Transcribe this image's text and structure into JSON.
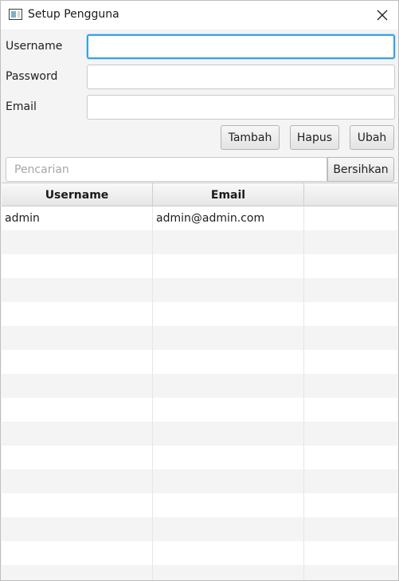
{
  "window": {
    "title": "Setup Pengguna",
    "icon": "app-window-icon",
    "close_icon": "close-icon"
  },
  "form": {
    "username": {
      "label": "Username",
      "value": "",
      "placeholder": ""
    },
    "password": {
      "label": "Password",
      "value": "",
      "placeholder": ""
    },
    "email": {
      "label": "Email",
      "value": "",
      "placeholder": ""
    }
  },
  "actions": {
    "add_label": "Tambah",
    "delete_label": "Hapus",
    "edit_label": "Ubah"
  },
  "search": {
    "placeholder": "Pencarian",
    "value": "",
    "clear_label": "Bersihkan"
  },
  "table": {
    "columns": [
      "Username",
      "Email",
      ""
    ],
    "rows": [
      [
        "admin",
        "admin@admin.com",
        ""
      ],
      [
        "",
        "",
        ""
      ],
      [
        "",
        "",
        ""
      ],
      [
        "",
        "",
        ""
      ],
      [
        "",
        "",
        ""
      ],
      [
        "",
        "",
        ""
      ],
      [
        "",
        "",
        ""
      ],
      [
        "",
        "",
        ""
      ],
      [
        "",
        "",
        ""
      ],
      [
        "",
        "",
        ""
      ],
      [
        "",
        "",
        ""
      ],
      [
        "",
        "",
        ""
      ],
      [
        "",
        "",
        ""
      ],
      [
        "",
        "",
        ""
      ],
      [
        "",
        "",
        ""
      ],
      [
        "",
        "",
        ""
      ]
    ]
  },
  "colors": {
    "focus_border": "#3aa0e0",
    "window_bg": "#f4f4f4",
    "alt_row": "#f4f4f4"
  }
}
